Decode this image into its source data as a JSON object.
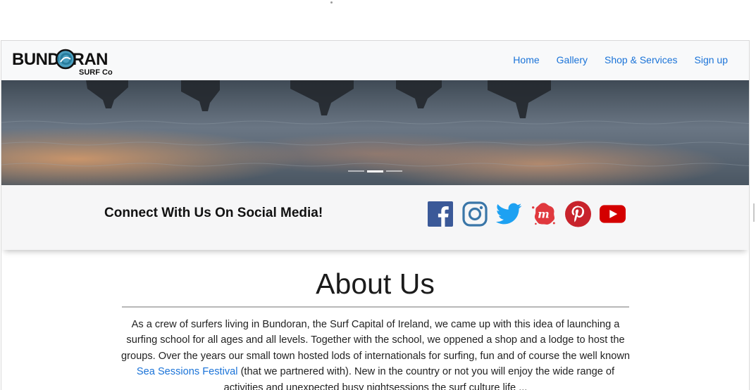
{
  "brand": {
    "name_line1": "BUNDORAN",
    "name_line2": "SURF Co"
  },
  "nav": {
    "links": [
      "Home",
      "Gallery",
      "Shop & Services",
      "Sign up"
    ]
  },
  "carousel": {
    "slide_count": 3,
    "active_index": 1
  },
  "social": {
    "heading": "Connect With Us On Social Media!",
    "icons": [
      "facebook-icon",
      "instagram-icon",
      "twitter-icon",
      "meetup-icon",
      "pinterest-icon",
      "youtube-icon"
    ],
    "colors": {
      "facebook": "#3b5998",
      "instagram": "#3a76a8",
      "twitter": "#1da1f2",
      "meetup": "#e0393e",
      "pinterest": "#c8232c",
      "youtube": "#d40000"
    }
  },
  "about": {
    "title": "About Us",
    "para_before_link": "As a crew of surfers living in Bundoran, the Surf Capital of Ireland, we came up with this idea of launching a surfing school for all ages and all levels. Together with the school, we oppened a shop and a lodge to host the groups. Over the years our small town hosted lods of internationals for surfing, fun and of course the well known",
    "link_text": "Sea Sessions Festival",
    "para_after_link": "(that we partnered with). New in the country or not you will enjoy the wide range of activities and unexpected busy nightsessions the surf culture life ..."
  },
  "accent_color": "#1a73d8"
}
